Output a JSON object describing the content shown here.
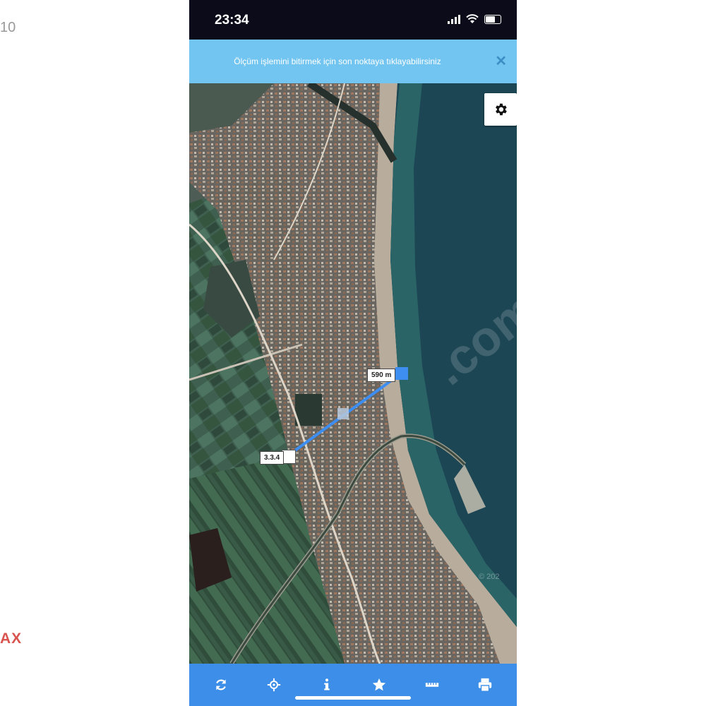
{
  "edge": {
    "left_top": "10",
    "left_bottom": "AX"
  },
  "status": {
    "time": "23:34"
  },
  "banner": {
    "text": "Ölçüm işlemini bitirmek için son noktaya tıklayabilirsiniz",
    "close": "✕"
  },
  "map": {
    "label_end": "590 m",
    "label_start": "3.3.4",
    "watermark": ".com",
    "copyright": "© 202"
  },
  "toolbar": {
    "items": [
      {
        "icon": "refresh-icon"
      },
      {
        "icon": "locate-icon"
      },
      {
        "icon": "info-icon"
      },
      {
        "icon": "star-icon"
      },
      {
        "icon": "ruler-icon"
      },
      {
        "icon": "print-icon"
      }
    ]
  },
  "colors": {
    "banner": "#72c5f0",
    "toolbar": "#3c8ee8",
    "measure_line": "#3d8ef0"
  }
}
